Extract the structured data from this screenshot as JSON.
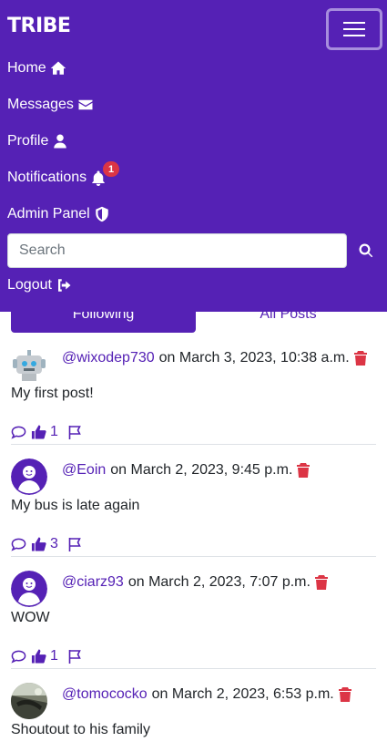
{
  "app": {
    "brand": "TRIBE"
  },
  "nav": {
    "items": [
      {
        "label": "Home",
        "icon": "home-icon"
      },
      {
        "label": "Messages",
        "icon": "envelope-icon"
      },
      {
        "label": "Profile",
        "icon": "user-icon"
      },
      {
        "label": "Notifications",
        "icon": "bell-icon",
        "badge": "1"
      },
      {
        "label": "Admin Panel",
        "icon": "shield-icon"
      }
    ],
    "search_placeholder": "Search",
    "logout": {
      "label": "Logout",
      "icon": "sign-out-icon"
    }
  },
  "tabs": {
    "following": "Following",
    "all": "All Posts"
  },
  "colors": {
    "brand": "#5521b5",
    "danger": "#dc3545",
    "border": "#dee2e6"
  },
  "posts": [
    {
      "user": "@wixodep730",
      "date": "on March 3, 2023, 10:38 a.m.",
      "text": "My first post!",
      "likes": "1",
      "avatar": "robot-avatar"
    },
    {
      "user": "@Eoin",
      "date": "on March 2, 2023, 9:45 p.m.",
      "text": "My bus is late again",
      "likes": "3",
      "avatar": "default-user-avatar"
    },
    {
      "user": "@ciarz93",
      "date": "on March 2, 2023, 7:07 p.m.",
      "text": "WOW",
      "likes": "1",
      "avatar": "default-user-avatar"
    },
    {
      "user": "@tomococko",
      "date": "on March 2, 2023, 6:53 p.m.",
      "text": "Shoutout to his family",
      "avatar": "photo-avatar"
    }
  ]
}
